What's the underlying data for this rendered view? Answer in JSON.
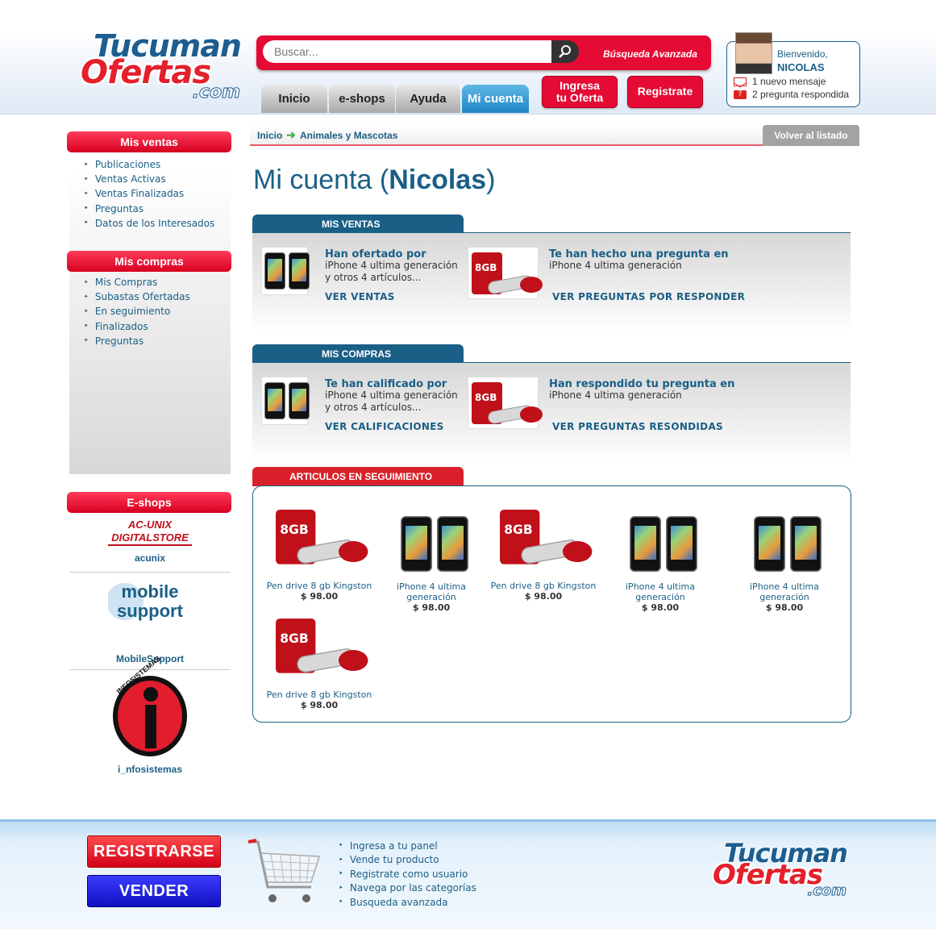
{
  "header": {
    "logo": {
      "line1": "Tucuman",
      "line2": "Ofertas",
      "line3": ".com"
    },
    "search": {
      "placeholder": "Buscar...",
      "advanced_label": "Búsqueda Avanzada"
    },
    "tabs": [
      {
        "label": "Inicio"
      },
      {
        "label": "e-shops"
      },
      {
        "label": "Ayuda"
      },
      {
        "label": "Mi cuenta"
      }
    ],
    "ingresa_line1": "Ingresa",
    "ingresa_line2": "tu Oferta",
    "registrate_label": "Registrate",
    "user": {
      "welcome": "Bienvenido,",
      "name": "NICOLAS",
      "messages": "1 nuevo mensaje",
      "answered": "2 pregunta respondida"
    }
  },
  "sidebar": {
    "ventas_title": "Mis ventas",
    "ventas_items": [
      "Publicaciones",
      "Ventas Activas",
      "Ventas Finalizadas",
      "Preguntas",
      "Datos de los Interesados"
    ],
    "compras_title": "Mis compras",
    "compras_items": [
      "Mis Compras",
      "Subastas Ofertadas",
      "En seguimiento",
      "Finalizados",
      "Preguntas"
    ],
    "eshops_title": "E-shops",
    "shops": [
      {
        "logo": "AC-UNIX DIGITALSTORE",
        "name": "acunix"
      },
      {
        "logo": "mobile support",
        "name": "MobileSupport"
      },
      {
        "logo": "INFOSISTEMAS",
        "name": "i_nfosistemas"
      }
    ]
  },
  "breadcrumb": {
    "home": "Inicio",
    "category": "Animales y Mascotas",
    "back_label": "Volver al listado"
  },
  "page": {
    "title_prefix": "Mi cuenta (",
    "title_name": "Nicolas",
    "title_suffix": ")"
  },
  "mis_ventas": {
    "tab_label": "MIS VENTAS",
    "left": {
      "title": "Han ofertado por",
      "line1": "iPhone 4 ultima generación",
      "line2": "y otros 4 artículos...",
      "link": "VER VENTAS"
    },
    "right": {
      "title": "Te han hecho una pregunta en",
      "line1": "iPhone 4 ultima generación",
      "link": "VER PREGUNTAS POR RESPONDER"
    }
  },
  "mis_compras": {
    "tab_label": "MIS COMPRAS",
    "left": {
      "title": "Te han calificado por",
      "line1": "iPhone 4 ultima generación",
      "line2": "y otros 4 artículos...",
      "link": "VER CALIFICACIONES"
    },
    "right": {
      "title": "Han respondido tu pregunta en",
      "line1": "iPhone 4 ultima generación",
      "link": "VER PREGUNTAS RESONDIDAS"
    }
  },
  "seguimiento": {
    "tab_label": "ARTICULOS EN SEGUIMIENTO",
    "items": [
      {
        "name": "Pen drive 8 gb Kingston",
        "price": "$ 98.00",
        "kind": "usb"
      },
      {
        "name": "iPhone 4 ultima generación",
        "price": "$ 98.00",
        "kind": "phone"
      },
      {
        "name": "Pen drive 8 gb Kingston",
        "price": "$ 98.00",
        "kind": "usb"
      },
      {
        "name": "iPhone 4 ultima generación",
        "price": "$ 98.00",
        "kind": "phone"
      },
      {
        "name": "iPhone 4 ultima generación",
        "price": "$ 98.00",
        "kind": "phone"
      },
      {
        "name": "Pen drive 8 gb Kingston",
        "price": "$ 98.00",
        "kind": "usb"
      }
    ]
  },
  "footer": {
    "registrarse_label": "REGISTRARSE",
    "vender_label": "VENDER",
    "links": [
      "Ingresa a tu panel",
      "Vende tu producto",
      "Registrate como usuario",
      "Navega por las categorías",
      "Busqueda avanzada"
    ]
  },
  "colors": {
    "brand_red": "#e50b34",
    "brand_blue": "#1a5f86",
    "tab_active": "#1e86c4"
  }
}
